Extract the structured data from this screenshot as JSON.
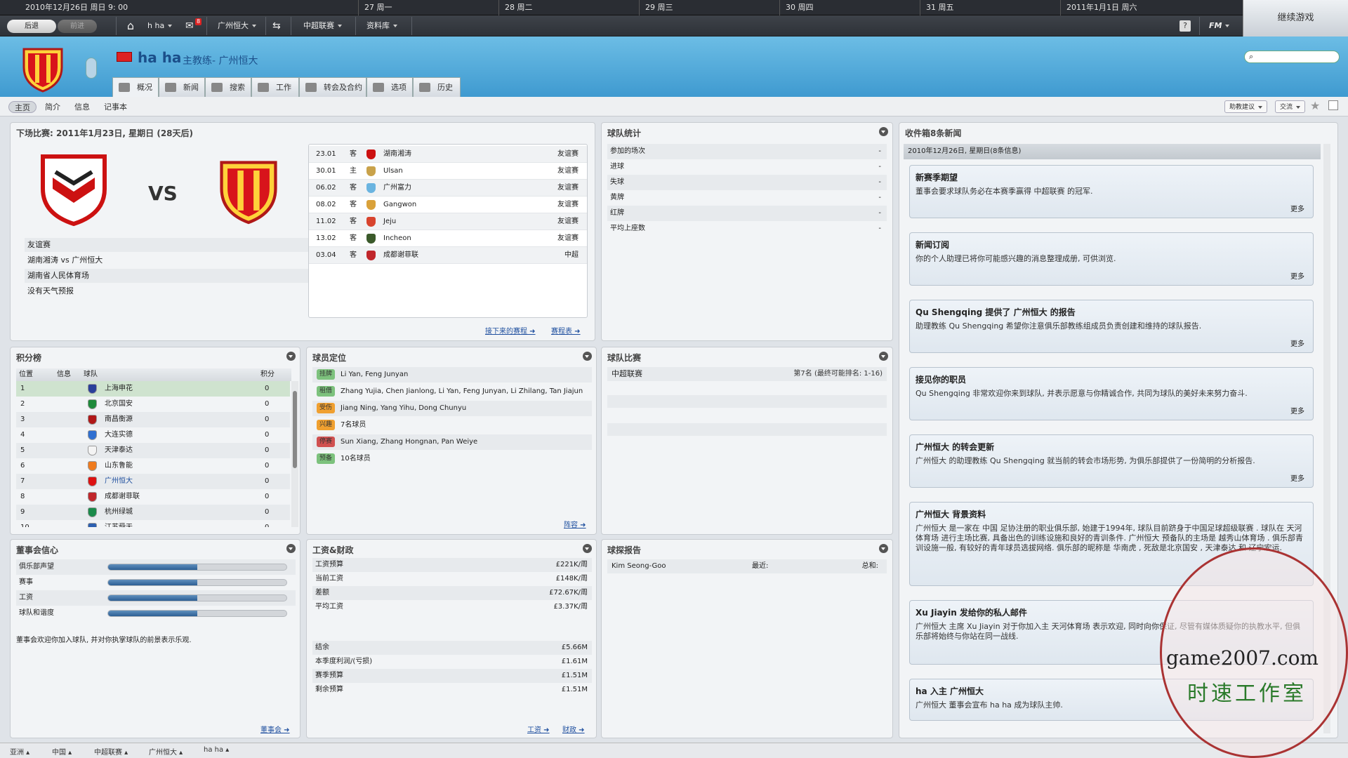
{
  "datebar": {
    "current": "2010年12月26日  周日 9: 00",
    "days": [
      "27 周一",
      "28 周二",
      "29 周三",
      "30 周四",
      "31 周五",
      "2011年1月1日  周六"
    ]
  },
  "nav": {
    "back": "后退",
    "forward": "前进",
    "user": "h ha",
    "team": "广州恒大",
    "league": "中超联赛",
    "database": "资料库",
    "fm": "FM",
    "continue": "继续游戏",
    "mail_count": "8"
  },
  "header": {
    "name": "ha ha",
    "role": "主教练- 广州恒大"
  },
  "tabs": [
    "概况",
    "新闻",
    "搜索",
    "工作",
    "转会及合约",
    "选项",
    "历史"
  ],
  "subtabs": [
    "主页",
    "简介",
    "信息",
    "记事本"
  ],
  "rightbtns": {
    "advice": "助教建议",
    "exchange": "交流"
  },
  "next_match": {
    "title": "下场比赛: 2011年1月23日, 星期日 (28天后)",
    "vs": "VS",
    "info": [
      "友谊赛",
      "湖南湘涛 vs 广州恒大",
      "湖南省人民体育场",
      "没有天气预报"
    ],
    "fixtures": [
      {
        "date": "23.01",
        "ha": "客",
        "team": "湖南湘涛",
        "comp": "友谊赛",
        "color": "#c11"
      },
      {
        "date": "30.01",
        "ha": "主",
        "team": "Ulsan",
        "comp": "友谊赛",
        "color": "#c9a24a"
      },
      {
        "date": "06.02",
        "ha": "客",
        "team": "广州富力",
        "comp": "友谊赛",
        "color": "#6ab4e0"
      },
      {
        "date": "08.02",
        "ha": "客",
        "team": "Gangwon",
        "comp": "友谊赛",
        "color": "#d9a13a"
      },
      {
        "date": "11.02",
        "ha": "客",
        "team": "Jeju",
        "comp": "友谊赛",
        "color": "#d8442e"
      },
      {
        "date": "13.02",
        "ha": "客",
        "team": "Incheon",
        "comp": "友谊赛",
        "color": "#3b5a2b"
      },
      {
        "date": "03.04",
        "ha": "客",
        "team": "成都谢菲联",
        "comp": "中超",
        "color": "#c0262b"
      }
    ],
    "link1": "接下来的赛程",
    "link2": "赛程表"
  },
  "stats": {
    "title": "球队统计",
    "rows": [
      [
        "参加的场次",
        "-"
      ],
      [
        "进球",
        "-"
      ],
      [
        "失球",
        "-"
      ],
      [
        "黄牌",
        "-"
      ],
      [
        "红牌",
        "-"
      ],
      [
        "平均上座数",
        "-"
      ]
    ]
  },
  "inbox": {
    "title": "收件箱8条新闻",
    "date": "2010年12月26日, 星期日(8条信息)",
    "more": "更多",
    "items": [
      {
        "title": "新赛季期望",
        "body": "董事会要求球队务必在本赛季赢得 中超联赛 的冠军.",
        "more": true
      },
      {
        "title": "新闻订阅",
        "body": "你的个人助理已将你可能感兴趣的消息整理成册, 可供浏览.",
        "more": true
      },
      {
        "title": "Qu Shengqing 提供了 广州恒大 的报告",
        "body": "助理教练 Qu Shengqing 希望你注意俱乐部教练组成员负责创建和维持的球队报告.",
        "more": true
      },
      {
        "title": "接见你的职员",
        "body": "Qu Shengqing 非常欢迎你来到球队, 并表示愿意与你精诚合作, 共同为球队的美好未来努力奋斗.",
        "more": true
      },
      {
        "title": "广州恒大 的转会更新",
        "body": "广州恒大 的助理教练 Qu Shengqing 就当前的转会市场形势, 为俱乐部提供了一份简明的分析报告.",
        "more": true
      },
      {
        "title": "广州恒大 背景资料",
        "body": "广州恒大 是一家在 中国 足协注册的职业俱乐部, 始建于1994年, 球队目前跻身于中国足球超级联赛 . 球队在 天河体育场 进行主场比赛, 具备出色的训练设施和良好的青训条件. 广州恒大 预备队的主场是 越秀山体育场 . 俱乐部青训设施一般, 有较好的青年球员选拔网络. 俱乐部的昵称是 华南虎 , 死敌是北京国安 , 天津泰达 和 辽宁宏运.",
        "more": false
      },
      {
        "title": "Xu Jiayin 发给你的私人邮件",
        "body": "广州恒大 主席 Xu Jiayin 对于你加入主 天河体育场 表示欢迎, 同时向你保证, 尽管有媒体质疑你的执教水平, 但俱乐部将始终与你站在同一战线.",
        "more": false
      },
      {
        "title": "ha 入主 广州恒大",
        "body": "广州恒大 董事会宣布 ha ha 成为球队主帅.",
        "more": false
      }
    ]
  },
  "league": {
    "title": "积分榜",
    "headers": [
      "位置",
      "信息",
      "球队",
      "积分"
    ],
    "rows": [
      {
        "pos": "1",
        "team": "上海申花",
        "pts": "0",
        "color": "#2a3f9a"
      },
      {
        "pos": "2",
        "team": "北京国安",
        "pts": "0",
        "color": "#1e8a3a"
      },
      {
        "pos": "3",
        "team": "南昌衡源",
        "pts": "0",
        "color": "#b01818"
      },
      {
        "pos": "4",
        "team": "大连实德",
        "pts": "0",
        "color": "#2f6fd0"
      },
      {
        "pos": "5",
        "team": "天津泰达",
        "pts": "0",
        "color": "#f4f4f4"
      },
      {
        "pos": "6",
        "team": "山东鲁能",
        "pts": "0",
        "color": "#ef7b1e"
      },
      {
        "pos": "7",
        "team": "广州恒大",
        "pts": "0",
        "color": "#d11"
      },
      {
        "pos": "8",
        "team": "成都谢菲联",
        "pts": "0",
        "color": "#c0262b"
      },
      {
        "pos": "9",
        "team": "杭州绿城",
        "pts": "0",
        "color": "#1a8a4a"
      },
      {
        "pos": "10",
        "team": "江苏舜天",
        "pts": "0",
        "color": "#2c5fb0"
      }
    ]
  },
  "squad": {
    "title": "球员定位",
    "rows": [
      {
        "tag": "挂牌",
        "tagcolor": "#7dc27d",
        "text": "Li Yan, Feng Junyan"
      },
      {
        "tag": "租借",
        "tagcolor": "#7dc27d",
        "text": "Zhang Yujia, Chen Jianlong, Li Yan, Feng Junyan, Li Zhilang, Tan Jiajun"
      },
      {
        "tag": "受伤",
        "tagcolor": "#f0a030",
        "text": "Jiang Ning, Yang Yihu, Dong Chunyu"
      },
      {
        "tag": "兴趣",
        "tagcolor": "#f0a030",
        "text": "7名球员"
      },
      {
        "tag": "停赛",
        "tagcolor": "#d05050",
        "text": "Sun Xiang, Zhang Hongnan, Pan Weiye"
      },
      {
        "tag": "预备",
        "tagcolor": "#7dc27d",
        "text": "10名球员"
      }
    ],
    "link": "阵容"
  },
  "comps": {
    "title": "球队比赛",
    "rows": [
      {
        "name": "中超联赛",
        "value": "第7名 (最终可能排名: 1-16)"
      }
    ]
  },
  "board": {
    "title": "董事会信心",
    "rows": [
      {
        "label": "俱乐部声望",
        "level": 50
      },
      {
        "label": "赛事",
        "level": 50
      },
      {
        "label": "工资",
        "level": 50
      },
      {
        "label": "球队和谐度",
        "level": 50
      }
    ],
    "note": "董事会欢迎你加入球队, 并对你执掌球队的前景表示乐观.",
    "link": "董事会"
  },
  "finance": {
    "title": "工资&财政",
    "rows": [
      [
        "工资预算",
        "£221K/周"
      ],
      [
        "当前工资",
        "£148K/周"
      ],
      [
        "差额",
        "£72.67K/周"
      ],
      [
        "平均工资",
        "£3.37K/周"
      ]
    ],
    "rows2": [
      [
        "结余",
        "£5.66M"
      ],
      [
        "本季度利润/(亏损)",
        "£1.61M"
      ],
      [
        "赛季预算",
        "£1.51M"
      ],
      [
        "剩余预算",
        "£1.51M"
      ]
    ],
    "link1": "工资",
    "link2": "财政"
  },
  "scout": {
    "title": "球探报告",
    "name": "Kim Seong-Goo",
    "recent": "最近:",
    "total": "总和:"
  },
  "footer": [
    "亚洲",
    "中国",
    "中超联赛",
    "广州恒大",
    "ha ha"
  ],
  "watermark": {
    "site": "game2007.com",
    "studio": "时速工作室"
  }
}
